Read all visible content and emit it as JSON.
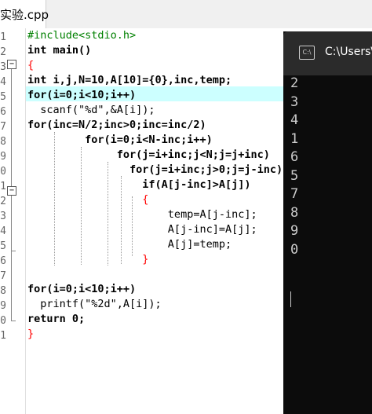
{
  "editor": {
    "tab_label": "实验.cpp",
    "line_numbers": [
      "1",
      "2",
      "3",
      "4",
      "5",
      "6",
      "7",
      "8",
      "9",
      "0",
      "1",
      "2",
      "3",
      "4",
      "5",
      "6",
      "7",
      "8",
      "9",
      "0",
      "1"
    ],
    "code": [
      {
        "t": "#include<stdio.h>",
        "c": "pp"
      },
      {
        "t": "int main()",
        "c": "kw"
      },
      {
        "t": "{",
        "c": "op"
      },
      {
        "t": "int i,j,N=10,A[10]={0},inc,temp;",
        "c": "kw"
      },
      {
        "t": "for(i=0;i<10;i++)",
        "c": "kw"
      },
      {
        "t": "  scanf(\"%d\",&A[i]);",
        "c": ""
      },
      {
        "t": "for(inc=N/2;inc>0;inc=inc/2)",
        "c": "kw"
      },
      {
        "t": "         for(i=0;i<N-inc;i++)",
        "c": "kw"
      },
      {
        "t": "              for(j=i+inc;j<N;j=j+inc)",
        "c": "kw"
      },
      {
        "t": "                for(j=i+inc;j>0;j=j-inc)",
        "c": "kw"
      },
      {
        "t": "                  if(A[j-inc]>A[j])",
        "c": "kw"
      },
      {
        "t": "                  {",
        "c": "op"
      },
      {
        "t": "                      temp=A[j-inc];",
        "c": ""
      },
      {
        "t": "                      A[j-inc]=A[j];",
        "c": ""
      },
      {
        "t": "                      A[j]=temp;",
        "c": ""
      },
      {
        "t": "                  }",
        "c": "op"
      },
      {
        "t": "",
        "c": ""
      },
      {
        "t": "for(i=0;i<10;i++)",
        "c": "kw"
      },
      {
        "t": "  printf(\"%2d\",A[i]);",
        "c": ""
      },
      {
        "t": "return 0;",
        "c": "kw"
      },
      {
        "t": "}",
        "c": "op"
      }
    ]
  },
  "console": {
    "title": "C:\\Users\\",
    "icon": "console-window-icon",
    "output": [
      "2",
      "3",
      "4",
      "1",
      "6",
      "5",
      "7",
      "8",
      "9",
      "0"
    ]
  }
}
